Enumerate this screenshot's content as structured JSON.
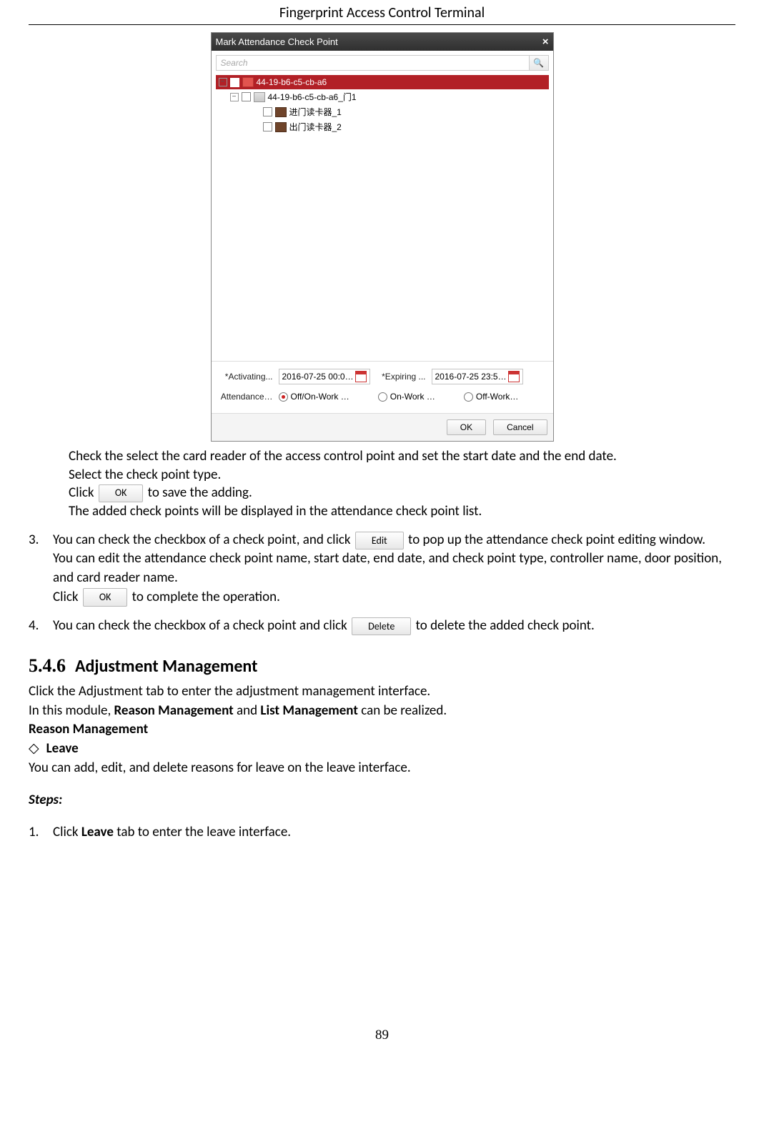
{
  "header": "Fingerprint Access Control Terminal",
  "dialog": {
    "title": "Mark Attendance Check Point",
    "search_placeholder": "Search",
    "tree": {
      "root": "44-19-b6-c5-cb-a6",
      "door": "44-19-b6-c5-cb-a6_门1",
      "reader1": "进门读卡器_1",
      "reader2": "出门读卡器_2"
    },
    "activating_label": "*Activating...",
    "activating_value": "2016-07-25 00:0…",
    "expiring_label": "*Expiring ...",
    "expiring_value": "2016-07-25 23:5…",
    "attendance_label": "Attendance…",
    "radio1": "Off/On-Work …",
    "radio2": "On-Work …",
    "radio3": "Off-Work…",
    "ok": "OK",
    "cancel": "Cancel"
  },
  "text": {
    "p1": "Check the select the card reader of the access control point and set the start date and the end date.",
    "p2": "Select the check point type.",
    "p3a": "Click",
    "p3b": "to save the adding.",
    "p4": "The added check points will be displayed in the attendance check point list.",
    "item3a": "You can check the checkbox of a check point, and click",
    "item3b": "to pop up the attendance check point editing window.",
    "item3c": "You can edit the attendance check point name, start date, end date, and check point type, controller name, door position, and card reader name.",
    "item3d": "Click",
    "item3e": "to complete the operation.",
    "item4a": "You can check the checkbox of a check point and click",
    "item4b": "to delete the added check point."
  },
  "buttons": {
    "ok": "OK",
    "edit": "Edit",
    "delete": "Delete"
  },
  "section": {
    "num": "5.4.6",
    "title": "Adjustment Management",
    "p1": "Click the Adjustment tab to enter the adjustment management interface.",
    "p2a": "In this module, ",
    "p2b": "Reason Management",
    "p2c": " and ",
    "p2d": "List Management",
    "p2e": " can be realized.",
    "reason_heading": "Reason Management",
    "leave": "Leave",
    "leave_desc": "You can add, edit, and delete reasons for leave on the leave interface.",
    "steps": "Steps:",
    "step1a": "Click ",
    "step1b": "Leave",
    "step1c": " tab to enter the leave interface."
  },
  "page_number": "89"
}
